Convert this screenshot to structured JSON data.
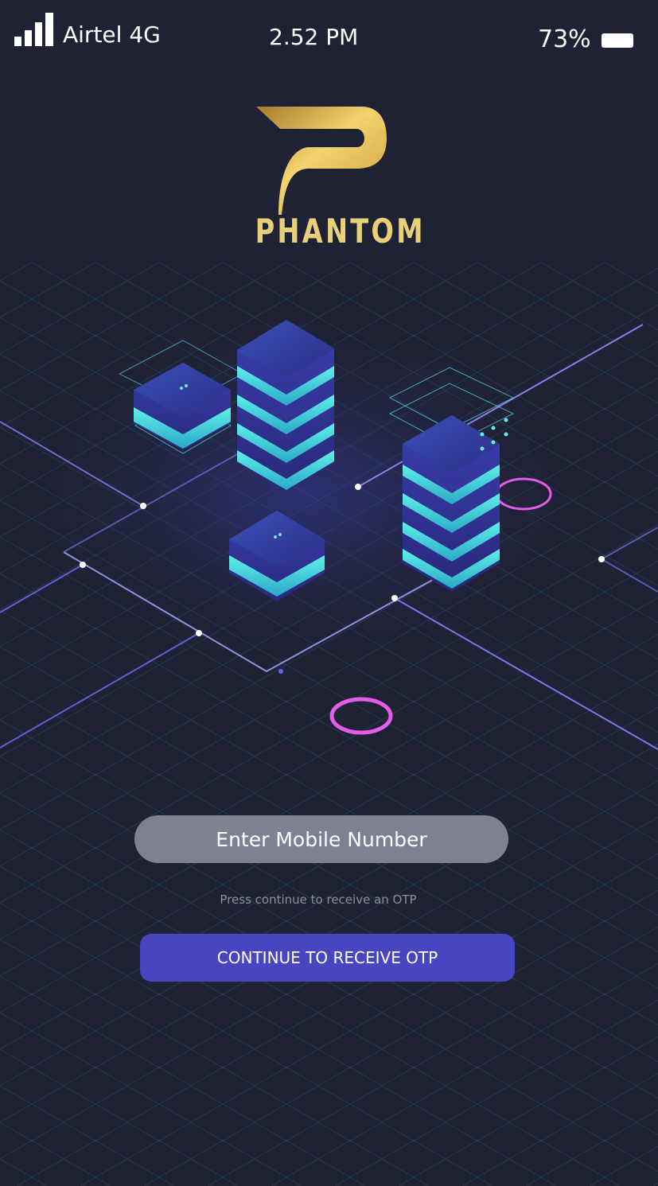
{
  "status_bar": {
    "carrier": "Airtel 4G",
    "time": "2.52 PM",
    "battery": "73%"
  },
  "brand": {
    "name": "PHANTOM",
    "logo_icon": "phantom-p-logo"
  },
  "hero": {
    "illustration": "isometric-server-racks"
  },
  "login": {
    "mobile_placeholder": "Enter Mobile Number",
    "hint": "Press continue to receive an OTP",
    "continue_label": "CONTINUE TO RECEIVE OTP"
  },
  "colors": {
    "background": "#1f2234",
    "accent": "#4845c0",
    "brand_gold": "#e8cf7a",
    "input_bg": "#7d8191"
  }
}
